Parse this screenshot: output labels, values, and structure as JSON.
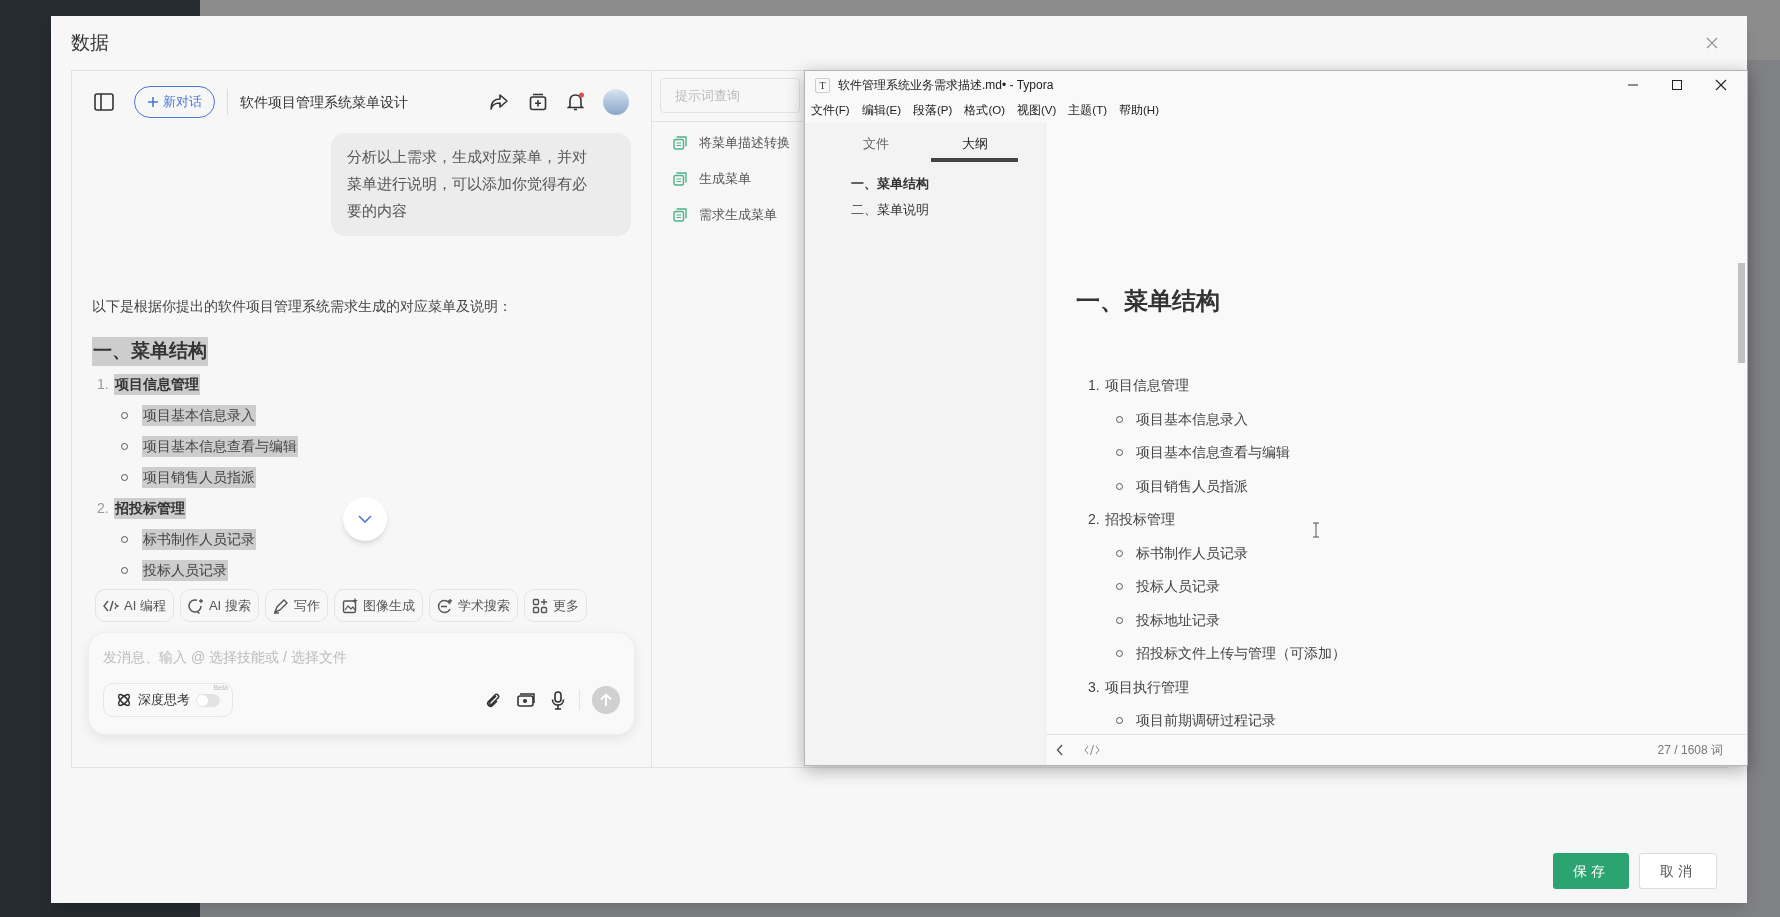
{
  "dialog": {
    "title": "数据",
    "buttons": [
      {
        "label": "保存",
        "kind": "primary"
      },
      {
        "label": "取消",
        "kind": "default"
      }
    ]
  },
  "chat": {
    "new_chat": "新对话",
    "title": "软件项目管理系统菜单设计",
    "user_message": "分析以上需求，生成对应菜单，并对菜单进行说明，可以添加你觉得有必要的内容",
    "intro": "以下是根据你提出的软件项目管理系统需求生成的对应菜单及说明：",
    "answer": {
      "selected": true,
      "heading": "一、菜单结构",
      "sections": [
        {
          "number": "1.",
          "label": "项目信息管理",
          "children": [
            {
              "label": "项目基本信息录入"
            },
            {
              "label": "项目基本信息查看与编辑"
            },
            {
              "label": "项目销售人员指派"
            }
          ]
        },
        {
          "number": "2.",
          "label": "招投标管理",
          "children": [
            {
              "label": "标书制作人员记录"
            },
            {
              "label": "投标人员记录"
            }
          ]
        }
      ]
    },
    "tools": [
      {
        "label": "AI 编程",
        "kind": "code"
      },
      {
        "label": "AI 搜索",
        "kind": "search"
      },
      {
        "label": "写作",
        "kind": "write"
      },
      {
        "label": "图像生成",
        "kind": "image"
      },
      {
        "label": "学术搜索",
        "kind": "academic"
      },
      {
        "label": "更多",
        "kind": "more"
      }
    ],
    "input": {
      "placeholder": "发消息、输入 @ 选择技能或 / 选择文件"
    },
    "deep_think": {
      "label": "深度思考",
      "badge": "Beta",
      "on": false
    }
  },
  "prompts": {
    "search_placeholder": "提示词查询",
    "items": [
      "将菜单描述转换",
      "生成菜单",
      "需求生成菜单"
    ]
  },
  "typora": {
    "title": "软件管理系统业务需求描述.md• - Typora",
    "app_icon": "T",
    "menu": [
      "文件(F)",
      "编辑(E)",
      "段落(P)",
      "格式(O)",
      "视图(V)",
      "主题(T)",
      "帮助(H)"
    ],
    "sidebar_tabs": [
      {
        "label": "文件",
        "selected": false
      },
      {
        "label": "大纲",
        "selected": true
      }
    ],
    "outline": [
      {
        "label": "一、菜单结构",
        "selected": true
      },
      {
        "label": "二、菜单说明",
        "selected": false
      }
    ],
    "heading": "一、菜单结构",
    "list": [
      {
        "number": "1.",
        "label": "项目信息管理",
        "children": [
          {
            "label": "项目基本信息录入"
          },
          {
            "label": "项目基本信息查看与编辑"
          },
          {
            "label": "项目销售人员指派"
          }
        ]
      },
      {
        "number": "2.",
        "label": "招投标管理",
        "children": [
          {
            "label": "标书制作人员记录"
          },
          {
            "label": "投标人员记录"
          },
          {
            "label": "投标地址记录"
          },
          {
            "label": "招投标文件上传与管理（可添加）"
          }
        ]
      },
      {
        "number": "3.",
        "label": "项目执行管理",
        "children": [
          {
            "label": "项目前期调研过程记录"
          }
        ]
      }
    ],
    "word_count": "27 / 1608 词"
  }
}
